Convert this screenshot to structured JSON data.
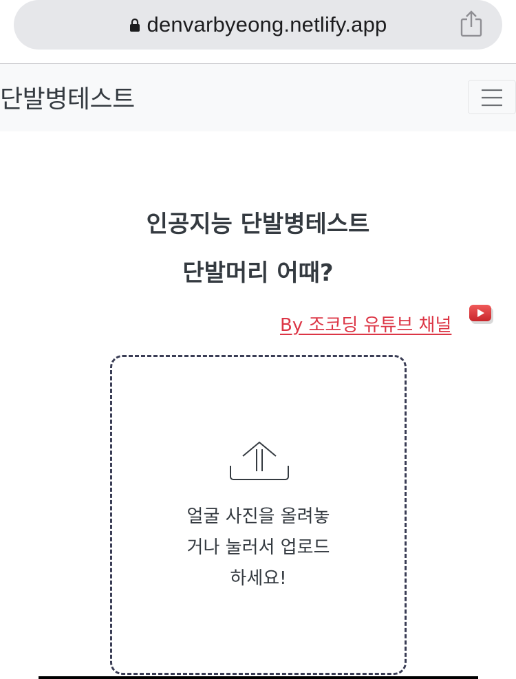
{
  "browser": {
    "url": "denvarbyeong.netlify.app",
    "lock_icon": "lock-icon",
    "share_icon": "share-icon"
  },
  "navbar": {
    "brand": "단발병테스트",
    "toggler_icon": "hamburger-icon"
  },
  "main": {
    "title_line1": "인공지능 단발병테스트",
    "title_line2": "단발머리 어때?",
    "youtube_link": "By 조코딩 유튜브 채널",
    "youtube_icon": "youtube-icon"
  },
  "upload": {
    "icon": "upload-icon",
    "line1": "얼굴 사진을 올려놓",
    "line2": "거나 눌러서 업로드",
    "line3": "하세요!"
  },
  "colors": {
    "link": "#dc3545",
    "navbar_bg": "#f8f9fa",
    "text": "#343a40",
    "url_bar_bg": "#e6e7ea"
  }
}
